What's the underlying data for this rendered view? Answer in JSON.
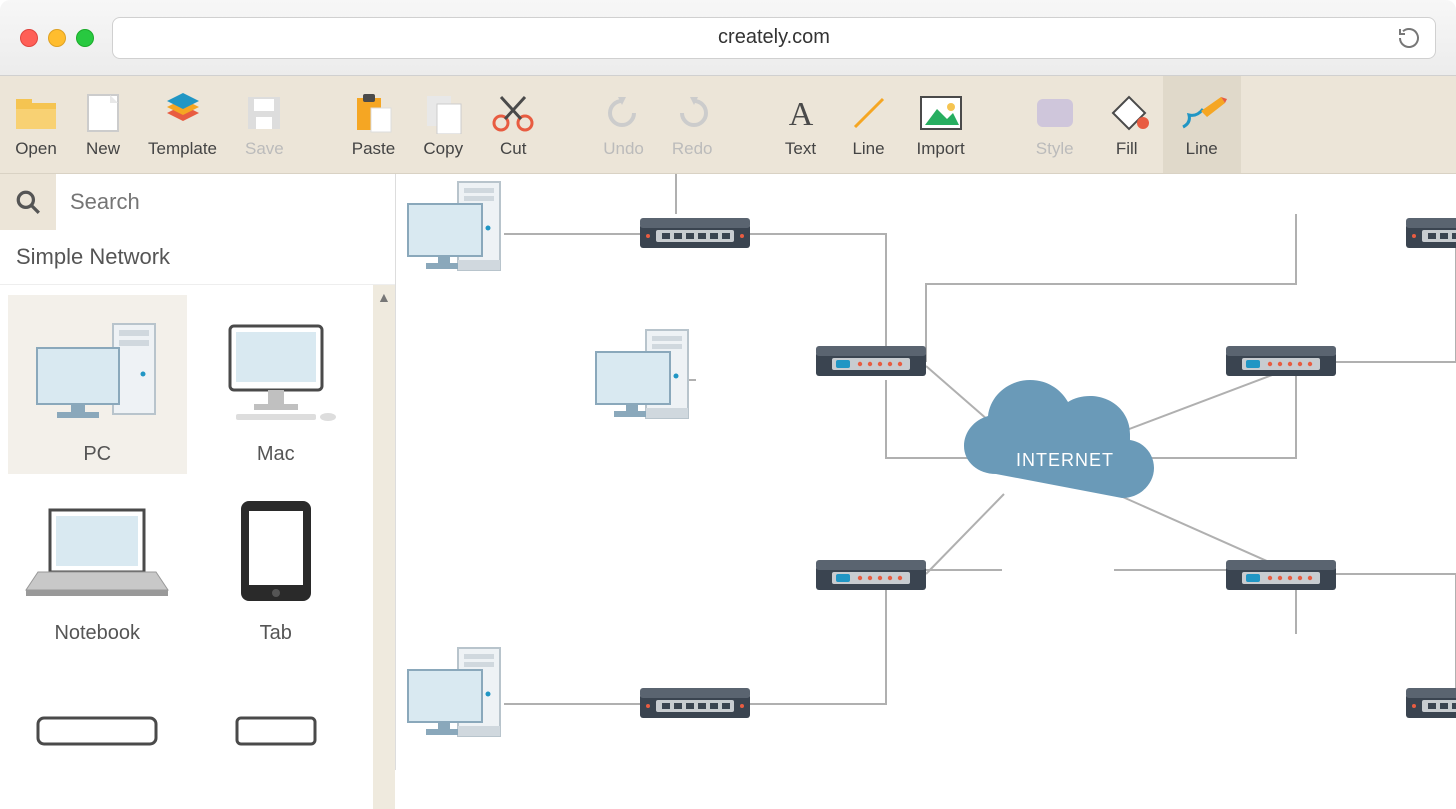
{
  "browser": {
    "url": "creately.com"
  },
  "toolbar": {
    "open": "Open",
    "new": "New",
    "template": "Template",
    "save": "Save",
    "paste": "Paste",
    "copy": "Copy",
    "cut": "Cut",
    "undo": "Undo",
    "redo": "Redo",
    "text": "Text",
    "line": "Line",
    "import": "Import",
    "style": "Style",
    "fill": "Fill",
    "line2": "Line"
  },
  "search": {
    "placeholder": "Search"
  },
  "group": {
    "title": "Simple Network"
  },
  "shapes": {
    "pc": "PC",
    "mac": "Mac",
    "notebook": "Notebook",
    "tab": "Tab"
  },
  "canvas": {
    "cloud_label": "INTERNET"
  },
  "colors": {
    "toolbar_bg": "#ece5d8",
    "cloud": "#6a9ab8",
    "router_body": "#3a4450",
    "router_top": "#5a6470",
    "monitor_fill": "#d9e9f1",
    "monitor_stroke": "#8aa8bb",
    "accent_orange": "#f5a623"
  }
}
